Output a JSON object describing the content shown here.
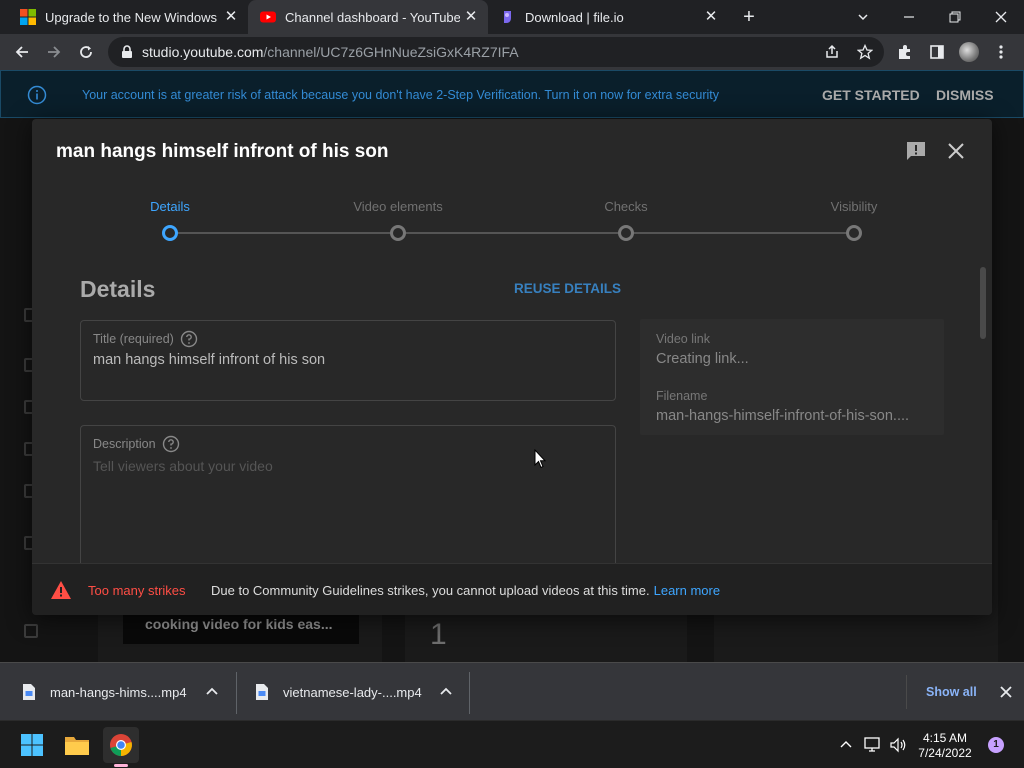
{
  "browser": {
    "tabs": [
      {
        "title": "Upgrade to the New Windows 11",
        "active": false
      },
      {
        "title": "Channel dashboard - YouTube Studio",
        "active": true
      },
      {
        "title": "Download | file.io",
        "active": false
      }
    ],
    "url_host": "studio.youtube.com",
    "url_path": "/channel/UC7z6GHnNueZsiGxK4RZ7IFA"
  },
  "banner": {
    "message": "Your account is at greater risk of attack because you don't have 2-Step Verification. Turn it on now for extra security",
    "get_started": "GET STARTED",
    "dismiss": "DISMISS"
  },
  "background": {
    "video_title": "cooking video for kids eas...",
    "stat": "1"
  },
  "dialog": {
    "title": "man hangs himself infront of his son",
    "steps": [
      "Details",
      "Video elements",
      "Checks",
      "Visibility"
    ],
    "active_step": 0,
    "section_title": "Details",
    "reuse_label": "REUSE DETAILS",
    "title_field": {
      "label": "Title (required)",
      "value": "man hangs himself infront of his son"
    },
    "description_field": {
      "label": "Description",
      "placeholder": "Tell viewers about your video"
    },
    "video_link_label": "Video link",
    "video_link_value": "Creating link...",
    "filename_label": "Filename",
    "filename_value": "man-hangs-himself-infront-of-his-son....",
    "strike_title": "Too many strikes",
    "strike_message": "Due to Community Guidelines strikes, you cannot upload videos at this time.",
    "learn_more": "Learn more"
  },
  "downloads": {
    "items": [
      "man-hangs-hims....mp4",
      "vietnamese-lady-....mp4"
    ],
    "show_all": "Show all"
  },
  "taskbar": {
    "time": "4:15 AM",
    "date": "7/24/2022",
    "notifications": "1"
  },
  "colors": {
    "accent": "#3ea6ff",
    "error": "#ff4e45",
    "dialog_bg": "#282828"
  }
}
